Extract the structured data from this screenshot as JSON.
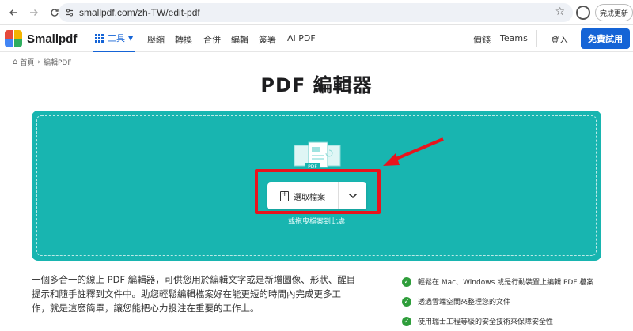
{
  "browser": {
    "url": "smallpdf.com/zh-TW/edit-pdf",
    "update_label": "完成更新",
    "icons": [
      "back-arrow-icon",
      "forward-arrow-icon",
      "reload-icon",
      "site-info-icon",
      "bookmark-star-icon",
      "profile-icon"
    ]
  },
  "header": {
    "brand": "Smallpdf",
    "tools_label": "工具",
    "nav": [
      "壓縮",
      "轉換",
      "合併",
      "編輯",
      "簽署",
      "AI PDF"
    ],
    "pricing": "價錢",
    "teams": "Teams",
    "login": "登入",
    "trial": "免費試用",
    "colors": {
      "accent": "#1564d6"
    }
  },
  "breadcrumb": {
    "home": "首頁",
    "current": "編輯PDF"
  },
  "main": {
    "title": "PDF 編輯器",
    "upload": {
      "button_label": "選取檔案",
      "drop_hint": "或拖曳檔案到此處",
      "pdf_badge": "PDF"
    },
    "colors": {
      "dropzone": "#18b5b0",
      "highlight": "#e8141d"
    }
  },
  "description": "一個多合一的線上 PDF 編輯器，可供您用於編輯文字或是新增圖像、形狀、醒目提示和隨手註釋到文件中。助您輕鬆編輯檔案好在能更短的時間內完成更多工作，就是這麼簡單，讓您能把心力投注在重要的工作上。",
  "features": [
    "輕鬆在 Mac、Windows 或是行動裝置上編輯 PDF 檔案",
    "透過雲端空間來整理您的文件",
    "使用瑞士工程等級的安全技術來保障安全性"
  ]
}
